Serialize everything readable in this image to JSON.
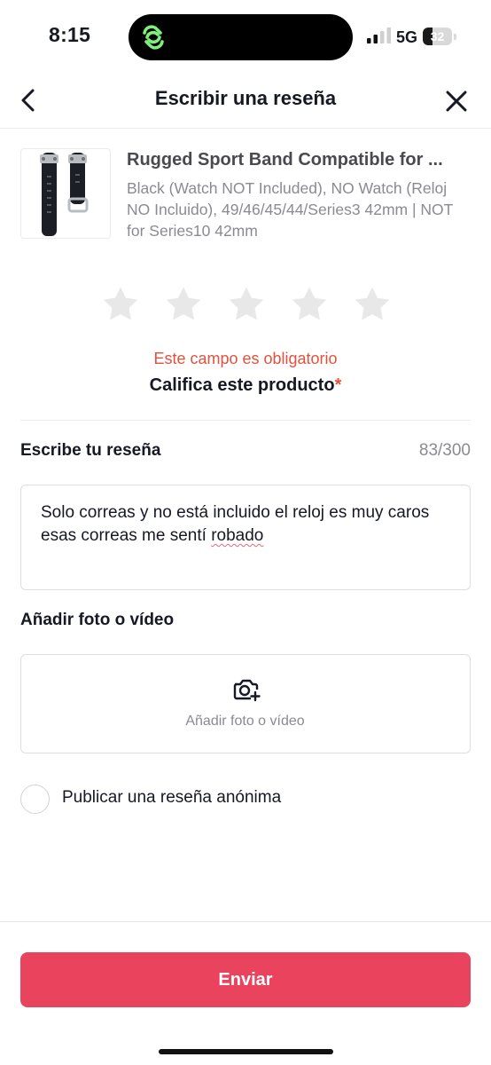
{
  "status_bar": {
    "time": "8:15",
    "network": "5G",
    "battery": "32",
    "battery_level": 0.32,
    "signal_icon": "cellular-signal-icon",
    "activity_icon": "linked-rings-icon",
    "activity_color": "#7ff07a"
  },
  "header": {
    "title": "Escribir una reseña",
    "back_icon": "chevron-left-icon",
    "close_icon": "close-icon"
  },
  "product": {
    "name": "Rugged Sport Band Compatible for ...",
    "variant": "Black (Watch NOT Included), NO Watch (Reloj NO Incluido), 49/46/45/44/Series3 42mm | NOT for Series10 42mm",
    "image_icon": "watch-band-thumbnail"
  },
  "rating": {
    "stars_total": 5,
    "stars_selected": 0,
    "star_icon": "star-icon",
    "star_color": "#e8e8e8",
    "error": "Este campo es obligatorio",
    "label": "Califica este producto",
    "required_mark": "*",
    "error_color": "#e0523f"
  },
  "review": {
    "label": "Escribe tu reseña",
    "count": "83/300",
    "text_before": "Solo correas y no está incluido el reloj es muy caros esas correas me sentí ",
    "text_flagged": "robado"
  },
  "media": {
    "label": "Añadir foto o vídeo",
    "placeholder": "Añadir foto o vídeo",
    "icon": "camera-plus-icon"
  },
  "anonymous": {
    "label": "Publicar una reseña anónima",
    "checked": false
  },
  "submit": {
    "label": "Enviar",
    "color": "#ea435d"
  }
}
